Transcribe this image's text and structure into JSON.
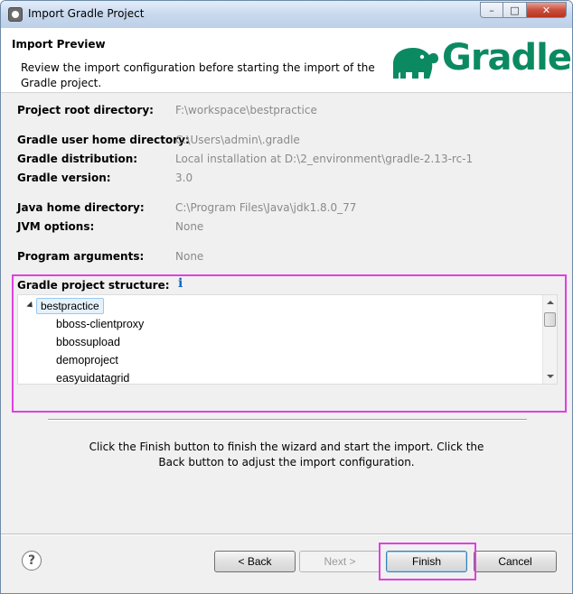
{
  "window": {
    "title": "Import Gradle Project",
    "controls": {
      "minimize": "–",
      "maximize": "□",
      "close": "✕"
    }
  },
  "header": {
    "title": "Import Preview",
    "description": "Review the import configuration before starting the import of the Gradle project.",
    "logo_text": "Gradle"
  },
  "config": {
    "project_root": {
      "label": "Project root directory:",
      "value": "F:\\workspace\\bestpractice"
    },
    "user_home": {
      "label": "Gradle user home directory:",
      "value": "C:\\Users\\admin\\.gradle"
    },
    "distribution": {
      "label": "Gradle distribution:",
      "value": "Local installation at D:\\2_environment\\gradle-2.13-rc-1"
    },
    "version": {
      "label": "Gradle version:",
      "value": "3.0"
    },
    "java_home": {
      "label": "Java home directory:",
      "value": "C:\\Program Files\\Java\\jdk1.8.0_77"
    },
    "jvm_options": {
      "label": "JVM options:",
      "value": "None"
    },
    "program_args": {
      "label": "Program arguments:",
      "value": "None"
    }
  },
  "structure": {
    "label": "Gradle project structure:",
    "info_icon": "i",
    "root": "bestpractice",
    "children": [
      "bboss-clientproxy",
      "bbossupload",
      "demoproject",
      "easyuidatagrid"
    ]
  },
  "finish_message": "Click the Finish button to finish the wizard and start the import. Click the Back button to adjust the import configuration.",
  "buttons": {
    "help": "?",
    "back": "< Back",
    "next": "Next >",
    "finish": "Finish",
    "cancel": "Cancel"
  },
  "colors": {
    "highlight": "#e040e0",
    "gradle_green": "#0b8a62"
  }
}
